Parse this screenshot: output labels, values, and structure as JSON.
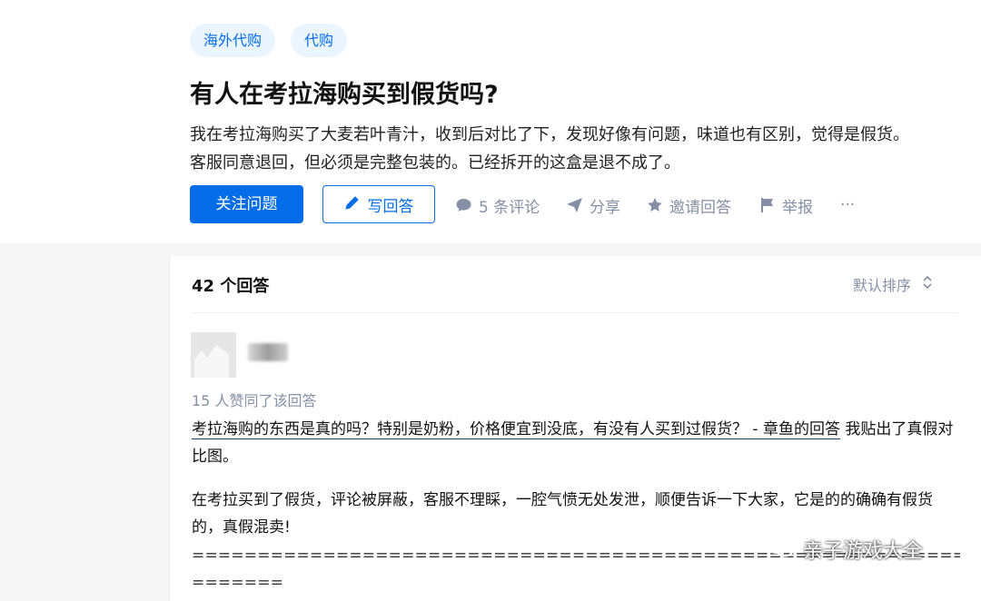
{
  "question": {
    "tags": [
      "海外代购",
      "代购"
    ],
    "title": "有人在考拉海购买到假货吗?",
    "description": [
      "我在考拉海购买了大麦若叶青汁，收到后对比了下，发现好像有问题，味道也有区别，觉得是假货。",
      "客服同意退回，但必须是完整包装的。已经拆开的这盒是退不成了。"
    ],
    "follow_label": "关注问题",
    "answer_label": "写回答",
    "actions": {
      "comments": "5 条评论",
      "share": "分享",
      "invite": "邀请回答",
      "report": "举报",
      "more": "···"
    }
  },
  "answers": {
    "count_label": "42 个回答",
    "sort_label": "默认排序",
    "first": {
      "voteup": "15 人赞同了该回答",
      "link_text": "考拉海购的东西是真的吗？特别是奶粉，价格便宜到没底，有没有人买到过假货？ - 章鱼的回答",
      "link_tail": " 我贴出了真假对比图。",
      "para2": "在考拉买到了假货，评论被屏蔽，客服不理睬，一腔气愤无处发泄，顺便告诉一下大家，它是的的确确有假货的，真假混卖!",
      "sep1": "==================================================================",
      "sep2": "======="
    }
  },
  "watermark": "亲子游戏大全",
  "colors": {
    "accent": "#056de8",
    "muted": "#8590a6",
    "tag_bg": "#ebf5ff"
  }
}
